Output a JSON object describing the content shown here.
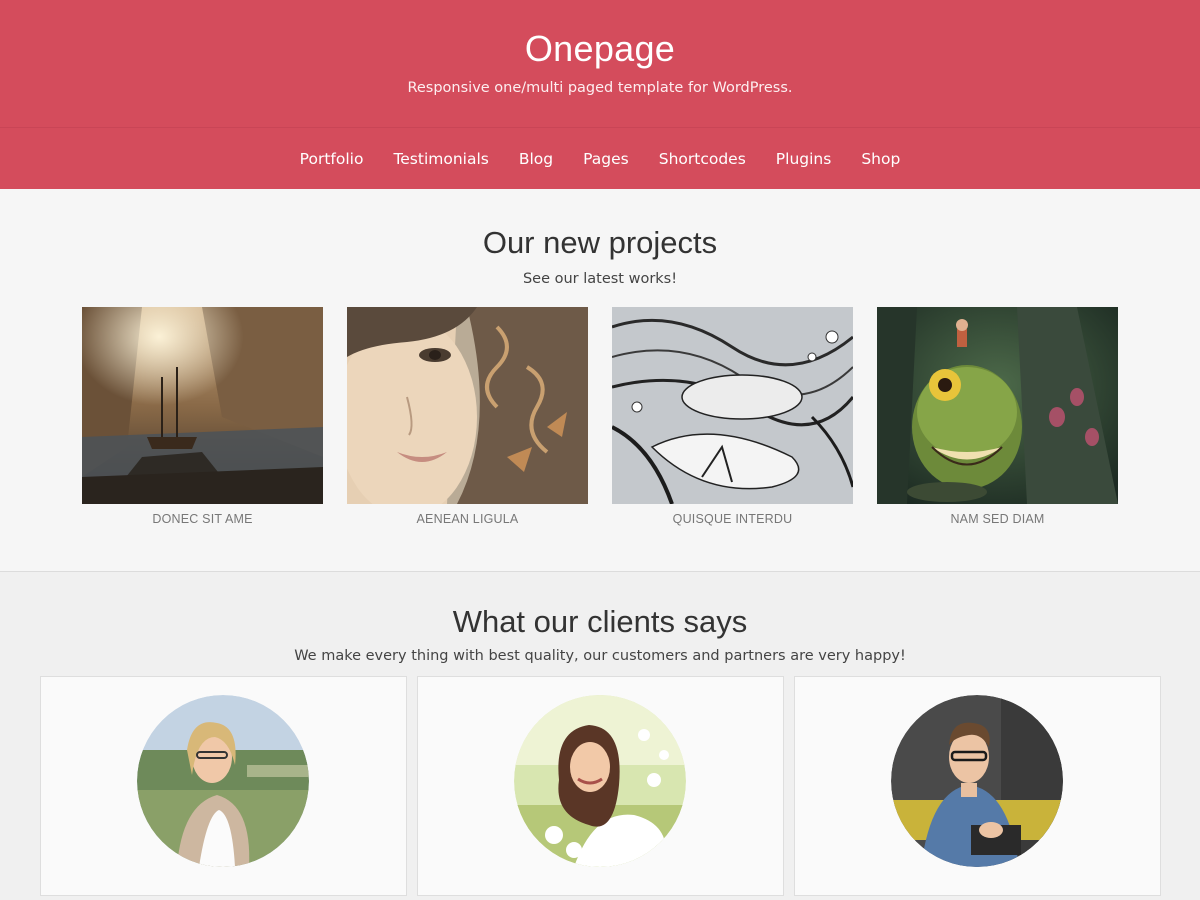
{
  "site": {
    "title": "Onepage",
    "tagline": "Responsive one/multi paged template for WordPress."
  },
  "nav": {
    "items": [
      "Portfolio",
      "Testimonials",
      "Blog",
      "Pages",
      "Shortcodes",
      "Plugins",
      "Shop"
    ]
  },
  "projects": {
    "title": "Our new projects",
    "subtitle": "See our latest works!",
    "items": [
      {
        "caption": "DONEC SIT AME",
        "image": "fantasy-canyon-ship-painting"
      },
      {
        "caption": "AENEAN LIGULA",
        "image": "illustrated-girl-face-with-ornaments"
      },
      {
        "caption": "QUISQUE INTERDU",
        "image": "ink-drawing-sleeping-woman-with-birds"
      },
      {
        "caption": "NAM SED DIAM",
        "image": "one-eyed-forest-monster-painting"
      }
    ]
  },
  "clients": {
    "title": "What our clients says",
    "subtitle": "We make every thing with best quality, our customers and partners are very happy!",
    "items": [
      {
        "avatar": "woman-blonde-glasses-portrait"
      },
      {
        "avatar": "woman-brunette-meadow-portrait"
      },
      {
        "avatar": "man-glasses-writing-portrait"
      }
    ]
  },
  "colors": {
    "brand": "#d44c5c",
    "background": "#f0f0f0"
  }
}
